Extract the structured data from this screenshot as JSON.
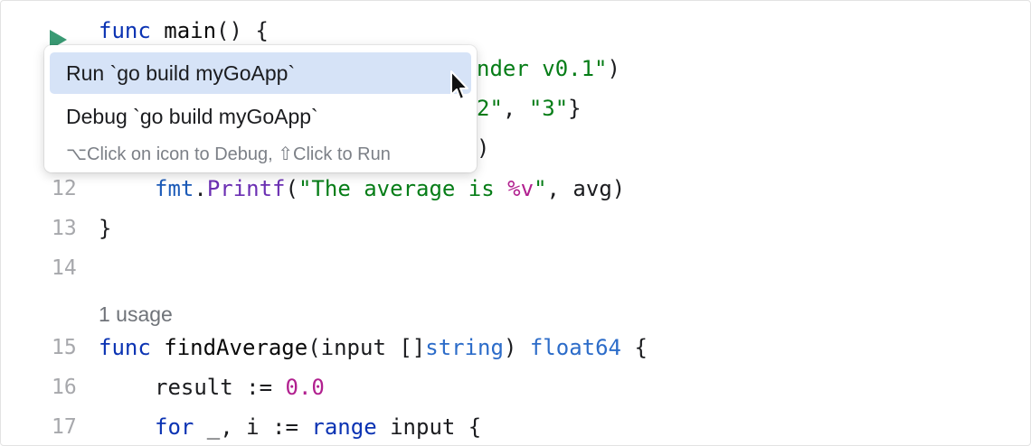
{
  "editor": {
    "line_main": {
      "kw": "func",
      "name": "main",
      "rest": "() {"
    },
    "line_10_tail": {
      "str": "nder v0.1\"",
      "rest": ")"
    },
    "line_11_tail": {
      "str1": "2\"",
      "sep": ", ",
      "str2": "\"3\"",
      "rest": "}"
    },
    "line_x_tail": ")",
    "line12": {
      "num": "12",
      "pkg": "fmt",
      "dot": ".",
      "call": "Printf",
      "open": "(",
      "str_a": "\"The average is ",
      "fmt": "%v",
      "str_b": "\"",
      "rest": ", avg)"
    },
    "line13": {
      "num": "13",
      "text": "}"
    },
    "line14": {
      "num": "14"
    },
    "usage": "1 usage",
    "line15": {
      "num": "15",
      "kw": "func",
      "name": "findAverage",
      "mid": "(input []",
      "type1": "string",
      "sp": ") ",
      "type2": "float64",
      "rest": " {"
    },
    "line16": {
      "num": "16",
      "text": "result := ",
      "val": "0.0"
    },
    "line17": {
      "num": "17",
      "kw1": "for",
      "mid": " _, i := ",
      "kw2": "range",
      "rest": " input {"
    }
  },
  "popup": {
    "run_label": "Run `go build myGoApp`",
    "debug_label": "Debug `go build myGoApp`",
    "hint": "⌥Click on icon to Debug, ⇧Click to Run"
  },
  "icons": {
    "run": "run-gutter-icon",
    "cursor": "mouse-pointer-icon"
  },
  "colors": {
    "run_icon": "#3a9b74",
    "selection": "#d6e3f7",
    "keyword": "#0b33b3",
    "string": "#067d17",
    "number": "#b1208f"
  }
}
